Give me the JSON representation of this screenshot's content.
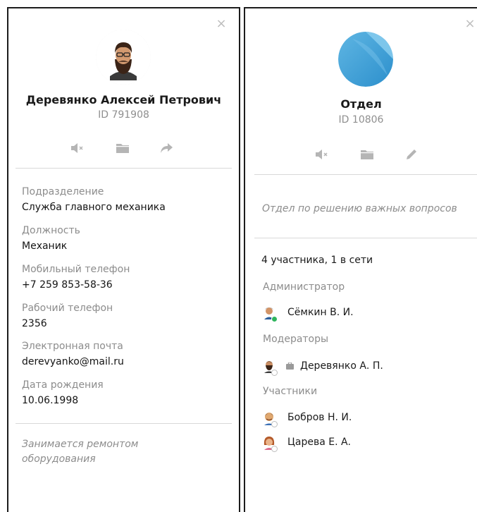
{
  "left_panel": {
    "close_glyph": "×",
    "name": "Деревянко Алексей Петрович",
    "id_text": "ID 791908",
    "actions": {
      "mute": "mute-icon",
      "folder": "folder-icon",
      "share": "share-icon"
    },
    "fields": [
      {
        "label": "Подразделение",
        "value": "Служба главного механика"
      },
      {
        "label": "Должность",
        "value": "Механик"
      },
      {
        "label": "Мобильный телефон",
        "value": "+7  259 853-58-36"
      },
      {
        "label": "Рабочий телефон",
        "value": "2356"
      },
      {
        "label": "Электронная почта",
        "value": "derevyanko@mail.ru"
      },
      {
        "label": "Дата рождения",
        "value": "10.06.1998"
      }
    ],
    "about": "Занимается ремонтом оборудования"
  },
  "right_panel": {
    "close_glyph": "×",
    "name": "Отдел",
    "id_text": "ID 10806",
    "actions": {
      "mute": "mute-icon",
      "folder": "folder-icon",
      "edit": "edit-pencil-icon"
    },
    "description": "Отдел по решению важных вопросов",
    "members_count": "4 участника, 1 в сети",
    "admin_label": "Администратор",
    "admin": {
      "name": "Сёмкин В. И.",
      "status_color": "#2fb55d"
    },
    "moderators_label": "Модераторы",
    "moderator": {
      "name": "Деревянко А. П."
    },
    "participants_label": "Участники",
    "participants": [
      {
        "name": "Бобров Н. И."
      },
      {
        "name": "Царева Е. А."
      }
    ]
  },
  "colors": {
    "icon_gray": "#b5b5b5",
    "text_muted": "#8c8c8c",
    "online": "#2fb55d",
    "avatar_blue": "#4aa3d8"
  }
}
